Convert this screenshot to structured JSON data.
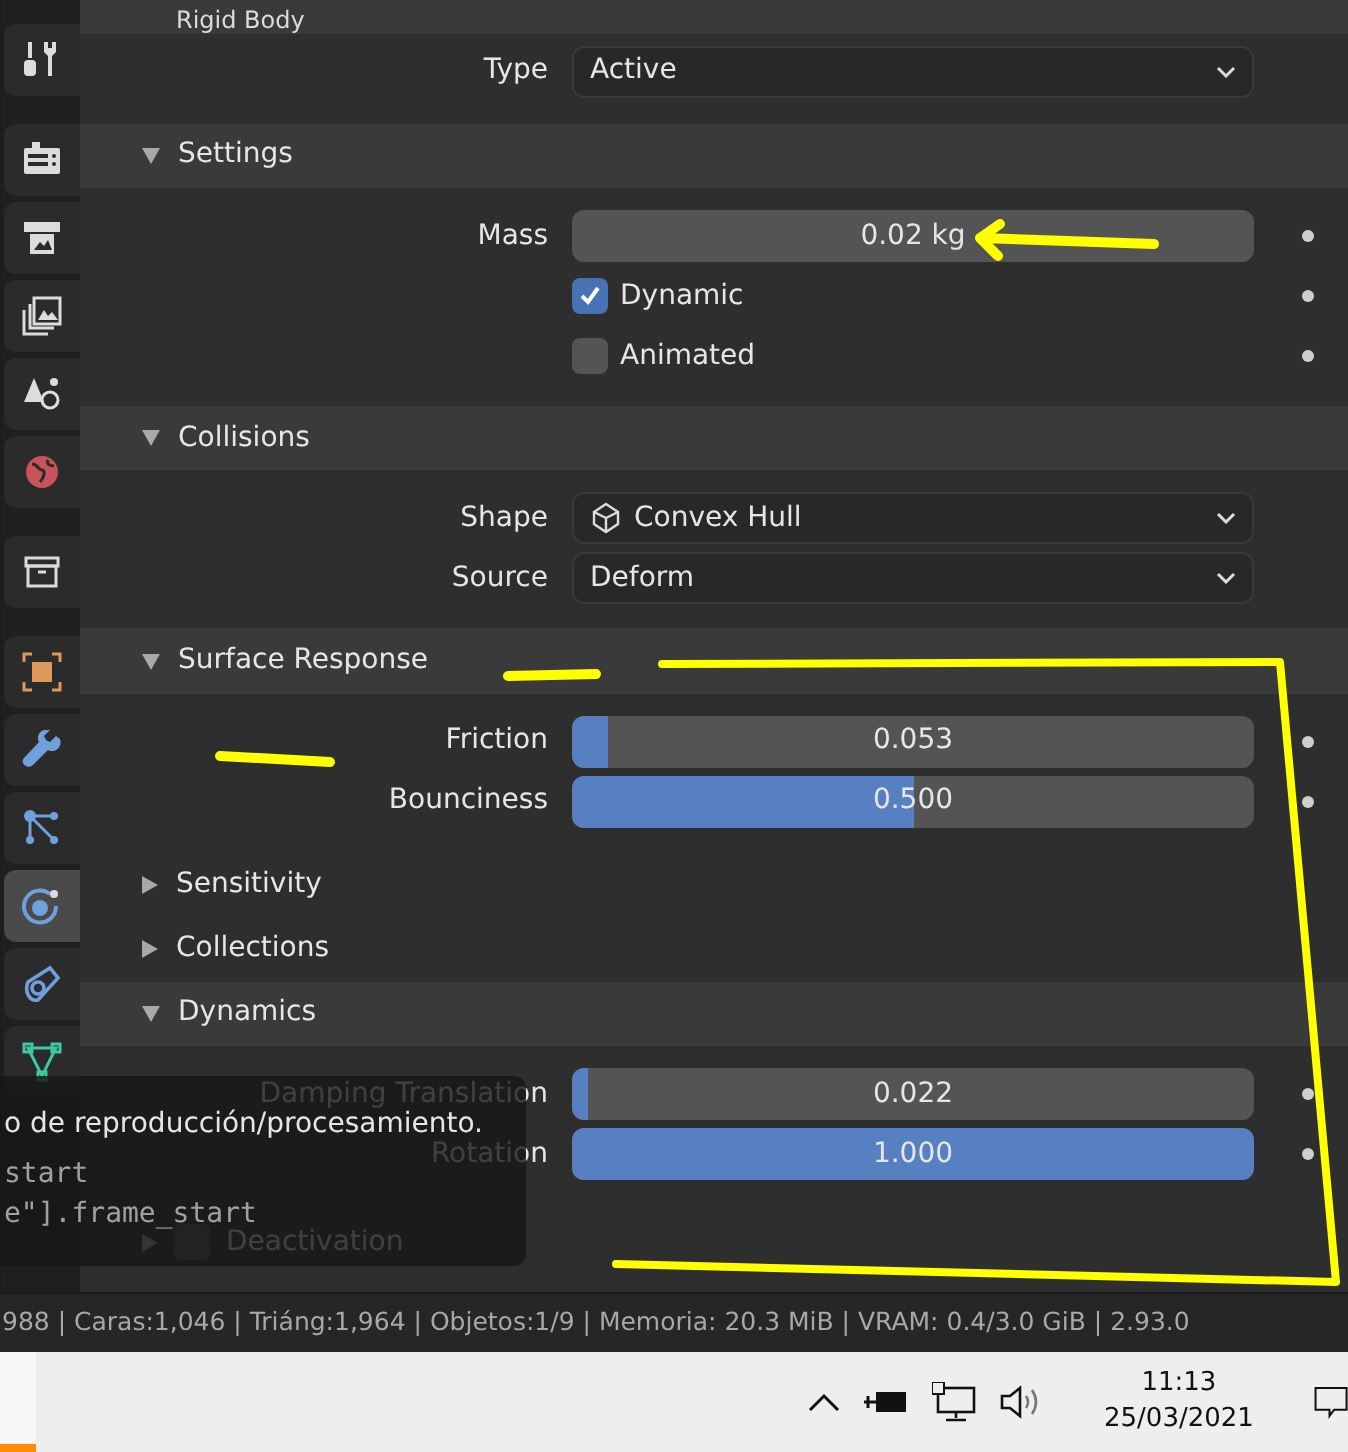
{
  "tabs": [
    {
      "kind": "tool",
      "selected": false
    },
    {
      "kind": "render",
      "selected": false
    },
    {
      "kind": "output",
      "selected": false
    },
    {
      "kind": "view_layer",
      "selected": false
    },
    {
      "kind": "scene",
      "selected": false
    },
    {
      "kind": "world",
      "selected": false
    },
    {
      "kind": "collection",
      "selected": false
    },
    {
      "kind": "object",
      "selected": false
    },
    {
      "kind": "modifiers",
      "selected": false
    },
    {
      "kind": "particles",
      "selected": false
    },
    {
      "kind": "physics",
      "selected": true
    },
    {
      "kind": "constraints",
      "selected": false
    },
    {
      "kind": "data",
      "selected": false
    }
  ],
  "rigid_body": {
    "title": "Rigid Body",
    "rows": [
      {
        "kind": "dropdown",
        "label": "Type",
        "value": "Active"
      }
    ]
  },
  "sections": [
    {
      "title": "Settings",
      "expanded": true,
      "rows": [
        {
          "kind": "number",
          "label": "Mass",
          "value": "0.02 kg"
        },
        {
          "kind": "checkbox",
          "label": "Dynamic",
          "checked": true
        },
        {
          "kind": "checkbox",
          "label": "Animated",
          "checked": false
        }
      ]
    },
    {
      "title": "Collisions",
      "expanded": true,
      "rows": [
        {
          "kind": "dropdown",
          "label": "Shape",
          "value": "Convex Hull",
          "icon": true
        },
        {
          "kind": "dropdown",
          "label": "Source",
          "value": "Deform"
        }
      ]
    },
    {
      "title": "Surface Response",
      "expanded": true,
      "rows": [
        {
          "kind": "slider",
          "label": "Friction",
          "value": "0.053",
          "level": 0.053
        },
        {
          "kind": "slider",
          "label": "Bounciness",
          "value": "0.500",
          "level": 0.5
        }
      ]
    },
    {
      "title": "Sensitivity",
      "expanded": false
    },
    {
      "title": "Collections",
      "expanded": false
    },
    {
      "title": "Dynamics",
      "expanded": true,
      "rows": [
        {
          "kind": "slider",
          "label": "Damping Translation",
          "value": "0.022",
          "level": 0.022
        },
        {
          "kind": "slider",
          "label": "Rotation",
          "value": "1.000",
          "level": 1.0
        },
        {
          "kind": "subpanel",
          "label": "Deactivation",
          "checked": false,
          "expanded": false
        }
      ]
    }
  ],
  "tooltip": {
    "lines": [
      {
        "kind": "text",
        "text": "o de reproducción/procesamiento."
      },
      {
        "kind": "code",
        "text": "start"
      },
      {
        "kind": "code",
        "text": "e\"].frame_start"
      }
    ]
  },
  "status_bar": {
    "text": "988 | Caras:1,046 | Triáng:1,964 | Objetos:1/9 | Memoria: 20.3 MiB | VRAM: 0.4/3.0 GiB | 2.93.0"
  },
  "taskbar": {
    "time": "11:13",
    "date": "25/03/2021"
  }
}
